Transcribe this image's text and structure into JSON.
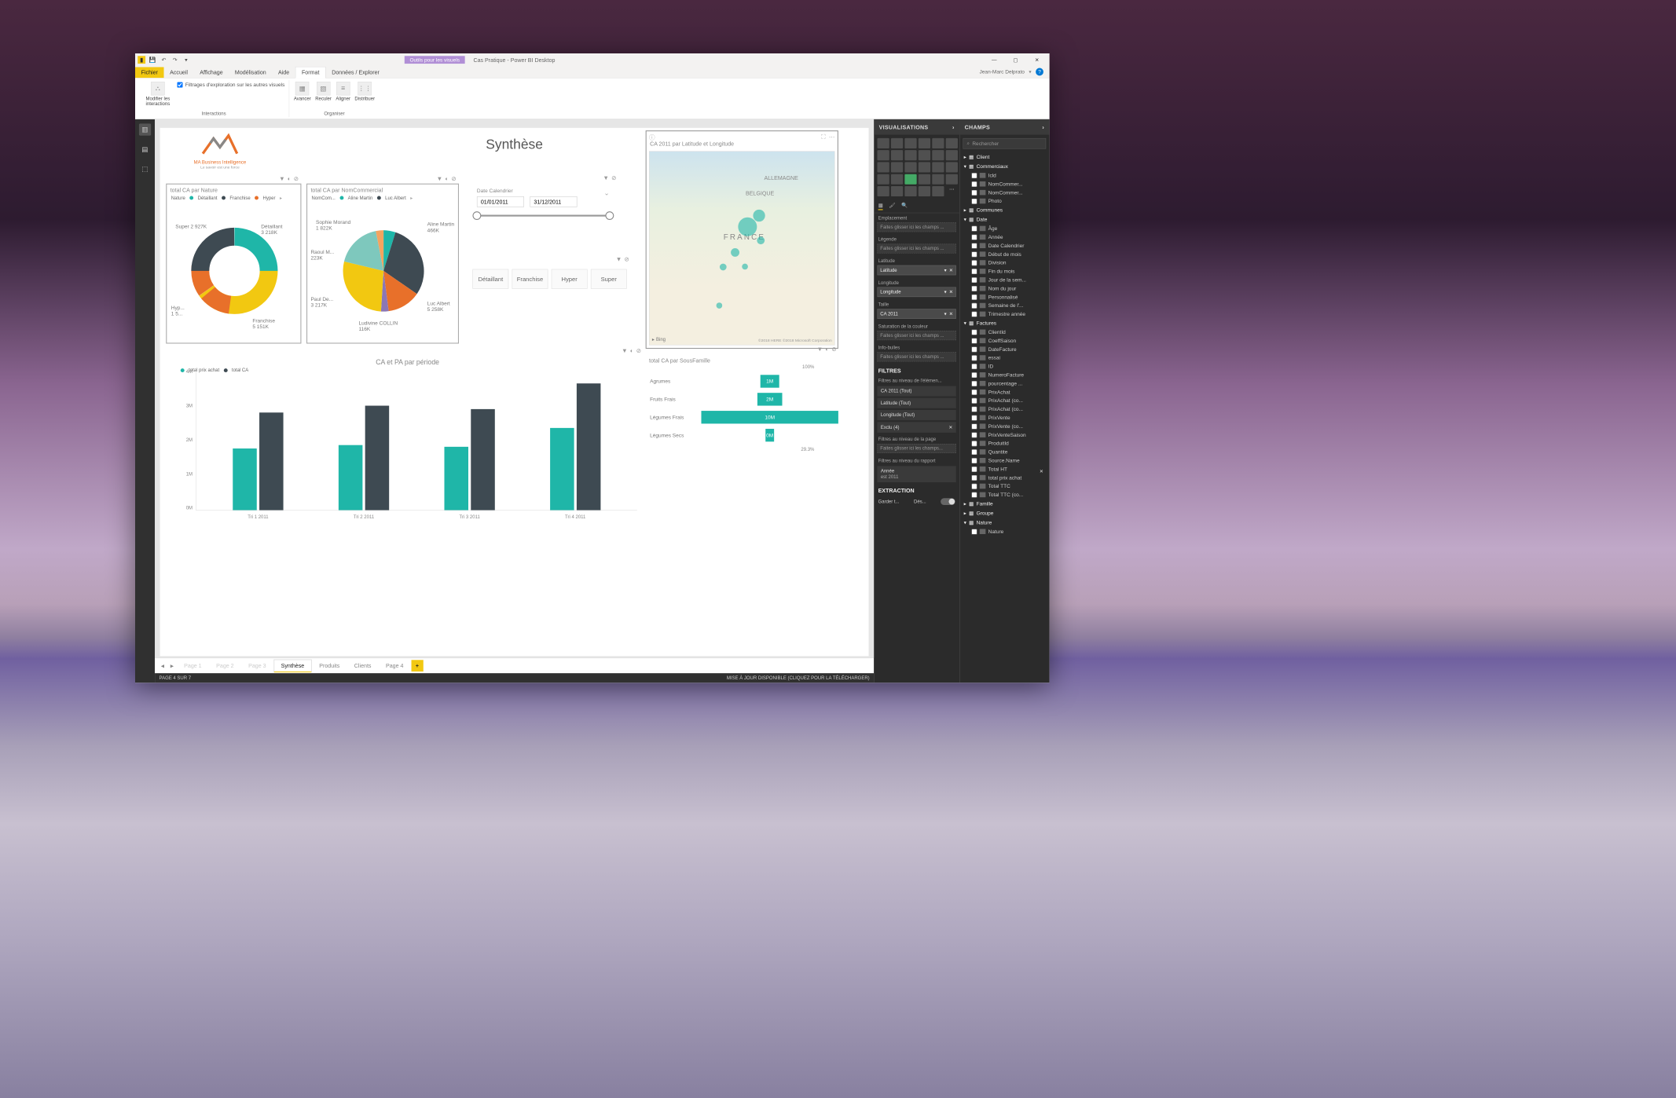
{
  "window": {
    "context_tab": "Outils pour les visuels",
    "title": "Cas Pratique - Power BI Desktop",
    "user": "Jean-Marc Delprato"
  },
  "ribbon_tabs": {
    "file": "Fichier",
    "tabs": [
      "Accueil",
      "Affichage",
      "Modélisation",
      "Aide",
      "Format",
      "Données / Explorer"
    ],
    "active": "Format"
  },
  "ribbon": {
    "interactions": {
      "edit_btn": "Modifier les interactions",
      "checkbox": "Filtrages d'exploration sur les autres visuels",
      "group_label": "Interactions"
    },
    "organize": {
      "btns": [
        "Avancer",
        "Reculer",
        "Aligner",
        "Distribuer"
      ],
      "group_label": "Organiser"
    }
  },
  "report": {
    "title": "Synthèse",
    "logo_line1": "MA Business Intelligence",
    "logo_line2": "Le savoir est une force",
    "donut": {
      "title": "total CA par Nature",
      "legend_label": "Nature",
      "items": [
        "Détaillant",
        "Franchise",
        "Hyper"
      ],
      "labels": [
        {
          "name": "Super 2 927K"
        },
        {
          "name": "Détaillant",
          "val": "3 218K"
        },
        {
          "name": "Hyp...",
          "val": "1 5..."
        },
        {
          "name": "Franchise",
          "val": "5 151K"
        }
      ]
    },
    "pie": {
      "title": "total CA par NomCommercial",
      "legend_label": "NomCom...",
      "items": [
        "Aline Martin",
        "Luc Albert"
      ],
      "labels": [
        {
          "name": "Sophie Morand",
          "val": "1 822K"
        },
        {
          "name": "Raoul M...",
          "val": "223K"
        },
        {
          "name": "Paul De...",
          "val": "3 217K"
        },
        {
          "name": "Ludivine COLLIN",
          "val": "116K"
        },
        {
          "name": "Aline Martin",
          "val": "466K"
        },
        {
          "name": "Luc Albert",
          "val": "5 258K"
        }
      ]
    },
    "date_slicer": {
      "label": "Date Calendrier",
      "from": "01/01/2011",
      "to": "31/12/2011"
    },
    "cat_slicer": [
      "Détaillant",
      "Franchise",
      "Hyper",
      "Super"
    ],
    "map": {
      "title": "CA 2011 par Latitude et Longitude",
      "attrib": "©2018 HERE ©2018 Microsoft Corporation",
      "bing": "Bing"
    },
    "barchart": {
      "title": "CA et PA par période",
      "legend": [
        "total prix achat",
        "total CA"
      ],
      "ylabels": [
        "4M",
        "3M",
        "2M",
        "1M",
        "0M"
      ],
      "categories": [
        "Tri 1 2011",
        "Tri 2 2011",
        "Tri 3 2011",
        "Tri 4 2011"
      ]
    },
    "hbar": {
      "title": "total CA par SousFamille",
      "top": "100%",
      "bottom": "29.3%",
      "rows": [
        {
          "cat": "Agrumes",
          "label": "1M",
          "pct": 14
        },
        {
          "cat": "Fruits Frais",
          "label": "2M",
          "pct": 18
        },
        {
          "cat": "Légumes Frais",
          "label": "10M",
          "pct": 100
        },
        {
          "cat": "Légumes Secs",
          "label": "0M",
          "pct": 6
        }
      ]
    }
  },
  "pagetabs": [
    "Page 1",
    "Page 2",
    "Page 3",
    "Synthèse",
    "Produits",
    "Clients",
    "Page 4"
  ],
  "status": {
    "left": "PAGE 4 SUR 7",
    "right": "MISE À JOUR DISPONIBLE (CLIQUEZ POUR LA TÉLÉCHARGER)"
  },
  "viz_panel": {
    "title": "VISUALISATIONS",
    "wells": [
      {
        "label": "Emplacement",
        "placeholder": "Faites glisser ici les champs ..."
      },
      {
        "label": "Légende",
        "placeholder": "Faites glisser ici les champs ..."
      },
      {
        "label": "Latitude",
        "value": "Latitude"
      },
      {
        "label": "Longitude",
        "value": "Longitude"
      },
      {
        "label": "Taille",
        "value": "CA 2011"
      },
      {
        "label": "Saturation de la couleur",
        "placeholder": "Faites glisser ici les champs ..."
      },
      {
        "label": "Info-bulles",
        "placeholder": "Faites glisser ici les champs ..."
      }
    ],
    "filters_title": "FILTRES",
    "filters_elem": "Filtres au niveau de l'élémen...",
    "filter_items": [
      "CA 2011  (Tout)",
      "Latitude  (Tout)",
      "Longitude  (Tout)",
      "Exclu (4)"
    ],
    "filters_page": "Filtres au niveau de la page",
    "filters_page_ph": "Faites glisser ici les champs...",
    "filters_report": "Filtres au niveau du rapport",
    "filter_year": {
      "label": "Année",
      "value": "est 2011"
    },
    "extraction": "EXTRACTION",
    "keep": "Garder t...",
    "off": "Dés..."
  },
  "fields_panel": {
    "title": "CHAMPS",
    "search": "Rechercher",
    "tables": [
      {
        "name": "Client",
        "expanded": false
      },
      {
        "name": "Commerciaux",
        "expanded": true,
        "fields": [
          "Icld",
          "NomCommer...",
          "NomCommer...",
          "Photo"
        ]
      },
      {
        "name": "Communes",
        "expanded": false
      },
      {
        "name": "Date",
        "expanded": true,
        "fields": [
          "Âge",
          "Année",
          "Date Calendrier",
          "Début de mois",
          "Division",
          "Fin du mois",
          "Jour de la sem...",
          "Nom du jour",
          "Personnalisé",
          "Semaine de l'...",
          "Trimestre année"
        ]
      },
      {
        "name": "Factures",
        "expanded": true,
        "fields": [
          "ClientId",
          "CoeffSaison",
          "DateFacture",
          "essai",
          "ID",
          "NumeroFacture",
          "pourcentage ...",
          "PrixAchat",
          "PrixAchat (co...",
          "PrixAchat (co...",
          "PrixVente",
          "PrixVente (co...",
          "PrixVenteSaison",
          "ProduitId",
          "Quantite",
          "Source.Name",
          "Total HT",
          "total prix achat",
          "Total TTC",
          "Total TTC (co..."
        ]
      },
      {
        "name": "Famille",
        "expanded": false
      },
      {
        "name": "Groupe",
        "expanded": false
      },
      {
        "name": "Nature",
        "expanded": true,
        "fields": [
          "Nature"
        ]
      }
    ]
  },
  "chart_data": [
    {
      "type": "bar",
      "title": "CA et PA par période",
      "categories": [
        "Tri 1 2011",
        "Tri 2 2011",
        "Tri 3 2011",
        "Tri 4 2011"
      ],
      "series": [
        {
          "name": "total prix achat",
          "values": [
            1.8,
            1.9,
            1.85,
            2.4
          ],
          "unit": "M"
        },
        {
          "name": "total CA",
          "values": [
            2.85,
            3.05,
            2.95,
            3.7
          ],
          "unit": "M"
        }
      ],
      "ylim": [
        0,
        4
      ],
      "ylabel": "",
      "colors": [
        "#1fb6a8",
        "#3e4a52"
      ]
    },
    {
      "type": "pie",
      "subtype": "donut",
      "title": "total CA par Nature",
      "series": [
        {
          "name": "Nature",
          "slices": [
            {
              "label": "Détaillant",
              "value": 3218
            },
            {
              "label": "Franchise",
              "value": 5151
            },
            {
              "label": "Hyper",
              "value": 1500
            },
            {
              "label": "Super",
              "value": 2927
            }
          ]
        }
      ],
      "unit": "K",
      "colors": [
        "#1fb6a8",
        "#f2c811",
        "#e8702a",
        "#3e4a52"
      ]
    },
    {
      "type": "pie",
      "title": "total CA par NomCommercial",
      "series": [
        {
          "name": "NomCommercial",
          "slices": [
            {
              "label": "Aline Martin",
              "value": 466
            },
            {
              "label": "Luc Albert",
              "value": 5258
            },
            {
              "label": "Ludivine COLLIN",
              "value": 116
            },
            {
              "label": "Paul De...",
              "value": 3217
            },
            {
              "label": "Raoul M...",
              "value": 223
            },
            {
              "label": "Sophie Morand",
              "value": 1822
            }
          ]
        }
      ],
      "unit": "K"
    },
    {
      "type": "bar",
      "orientation": "horizontal",
      "title": "total CA par SousFamille",
      "categories": [
        "Agrumes",
        "Fruits Frais",
        "Légumes Frais",
        "Légumes Secs"
      ],
      "values": [
        1,
        2,
        10,
        0.3
      ],
      "unit": "M",
      "pct_top": "100%",
      "pct_bottom": "29.3%"
    }
  ]
}
